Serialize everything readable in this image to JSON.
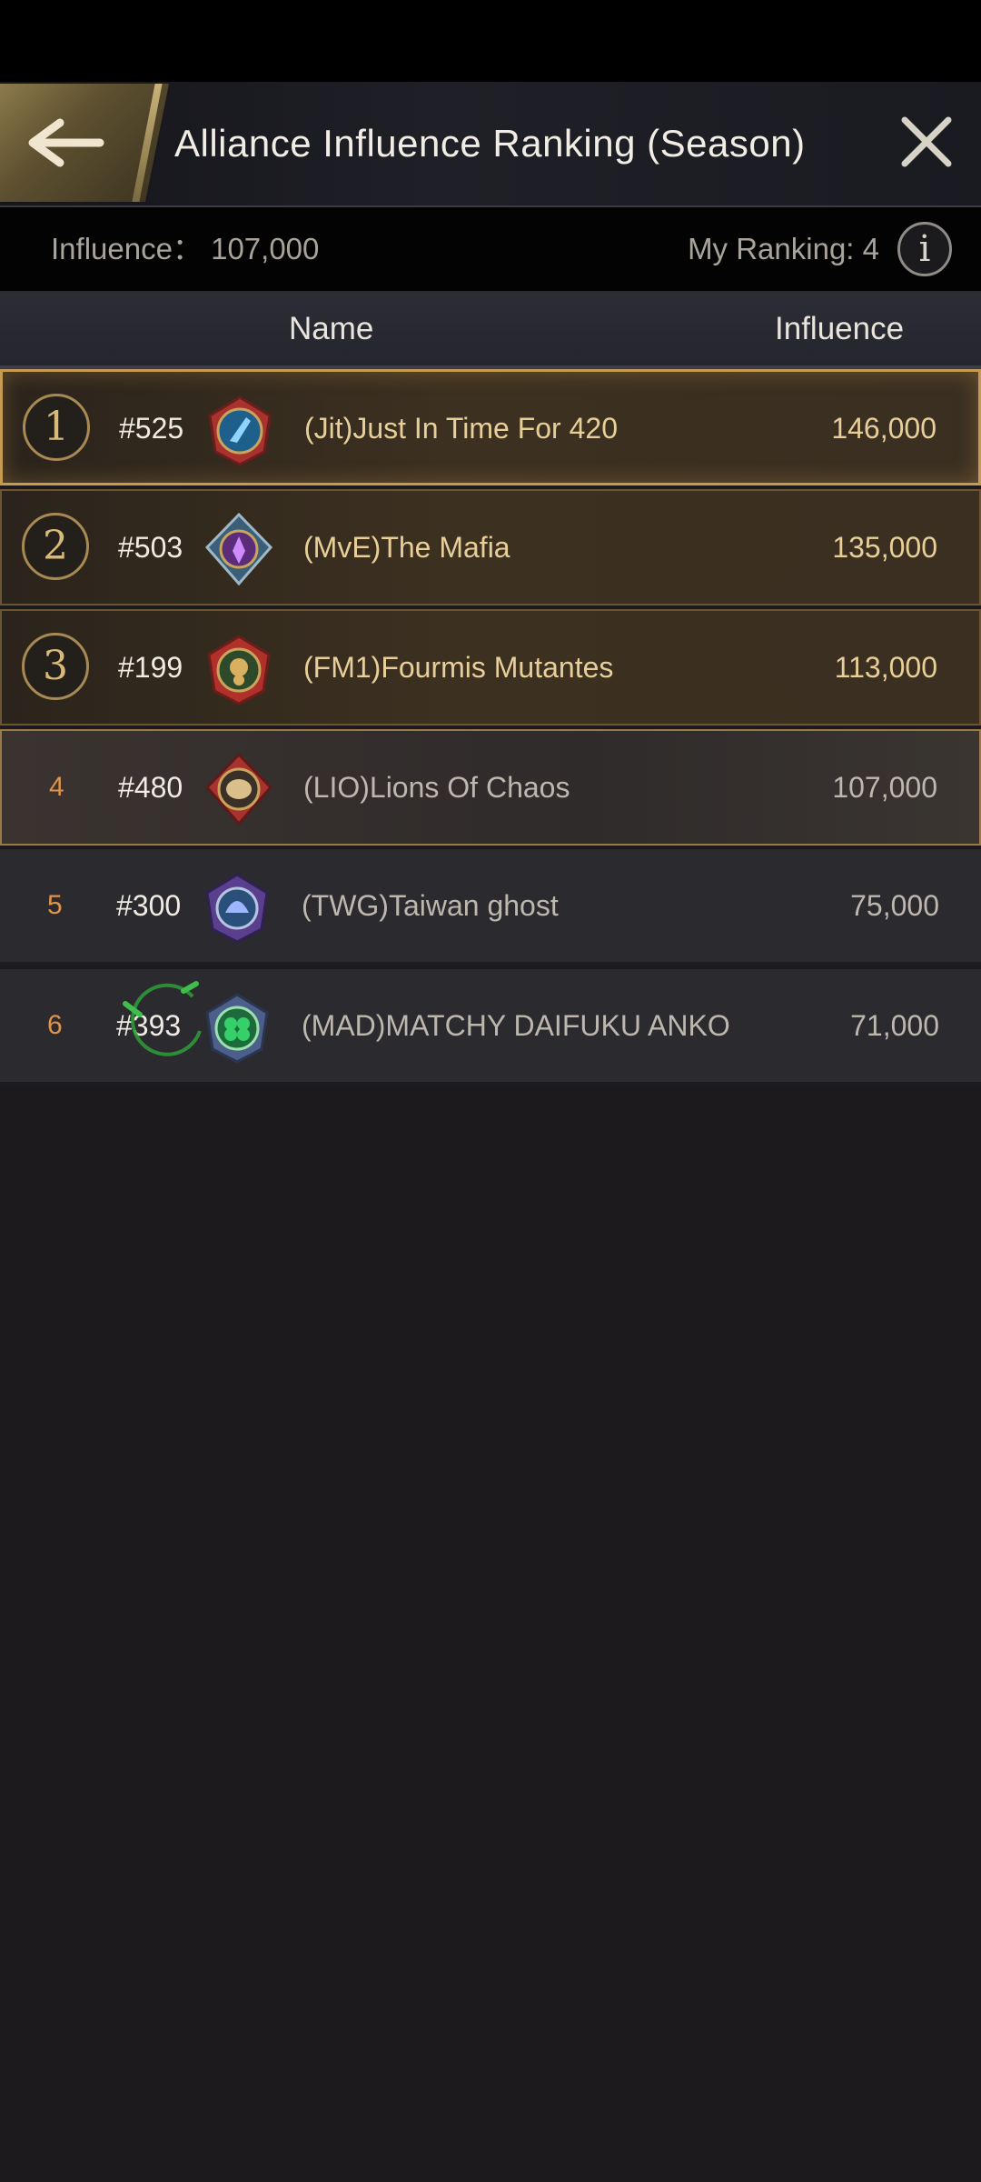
{
  "header": {
    "title": "Alliance Influence Ranking (Season)",
    "back_icon": "back-arrow-icon",
    "close_icon": "close-icon"
  },
  "summary": {
    "influence_text": "Influence： 107,000",
    "my_ranking_text": "My Ranking: 4",
    "info_icon": "info-icon"
  },
  "columns": {
    "name": "Name",
    "influence": "Influence"
  },
  "rows": [
    {
      "rank": "1",
      "server": "#525",
      "alliance": "(Jit)Just In Time For 420",
      "influence": "146,000",
      "emblem": "emblem-blue-red"
    },
    {
      "rank": "2",
      "server": "#503",
      "alliance": "(MvE)The Mafia",
      "influence": "135,000",
      "emblem": "emblem-purple-teal"
    },
    {
      "rank": "3",
      "server": "#199",
      "alliance": "(FM1)Fourmis Mutantes",
      "influence": "113,000",
      "emblem": "emblem-red-gold"
    },
    {
      "rank": "4",
      "server": "#480",
      "alliance": "(LIO)Lions Of Chaos",
      "influence": "107,000",
      "emblem": "emblem-gold-red"
    },
    {
      "rank": "5",
      "server": "#300",
      "alliance": "(TWG)Taiwan ghost",
      "influence": "75,000",
      "emblem": "emblem-purple-blue"
    },
    {
      "rank": "6",
      "server": "#393",
      "alliance": "(MAD)MATCHY DAIFUKU ANKO",
      "influence": "71,000",
      "emblem": "emblem-green-clover"
    }
  ],
  "colors": {
    "gold": "#c59a53",
    "accent_orange": "#e09348",
    "text_gold": "#e8cf99"
  }
}
